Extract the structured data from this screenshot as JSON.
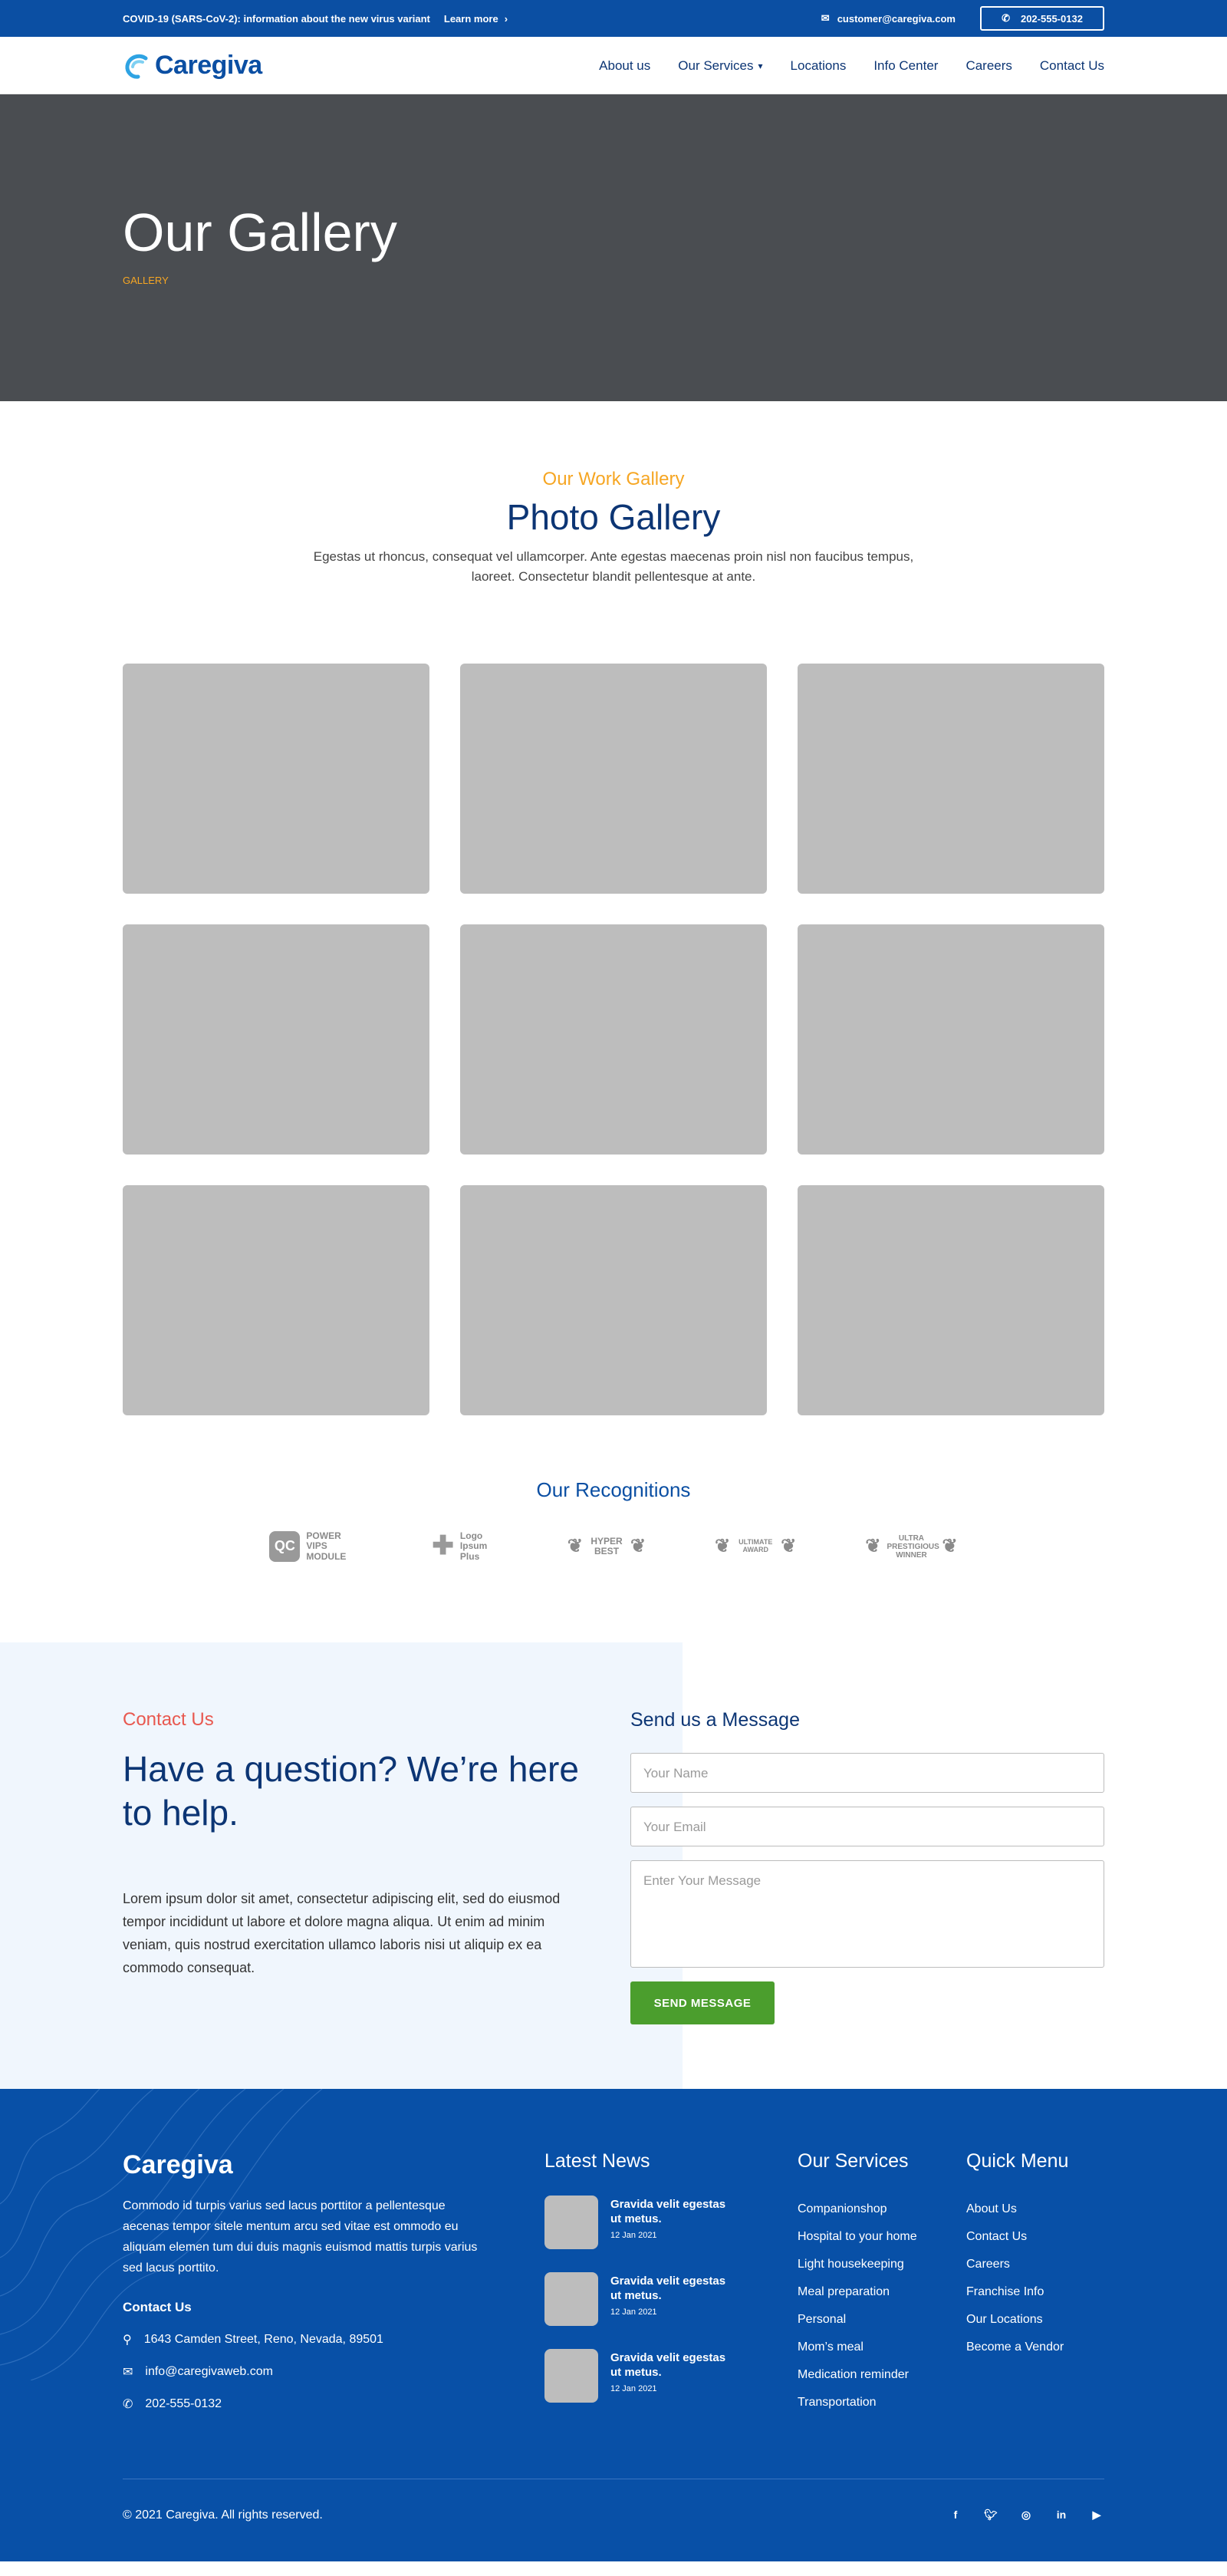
{
  "topbar": {
    "notice": "COVID-19 (SARS-CoV-2): information about the new virus variant",
    "learn_more": "Learn more",
    "email": "customer@caregiva.com",
    "phone": "202-555-0132"
  },
  "nav": {
    "logo": "Caregiva",
    "items": [
      "About us",
      "Our Services",
      "Locations",
      "Info Center",
      "Careers",
      "Contact Us"
    ]
  },
  "hero": {
    "title": "Our Gallery",
    "breadcrumb": "GALLERY"
  },
  "gallery": {
    "kicker": "Our Work Gallery",
    "title": "Photo Gallery",
    "description": "Egestas ut rhoncus, consequat vel ullamcorper. Ante egestas maecenas proin nisl non faucibus tempus, laoreet. Consectetur blandit pellentesque at ante."
  },
  "recognitions": {
    "title": "Our Recognitions",
    "badges": [
      "POWER VIPS MODULE",
      "Logo Ipsum Plus",
      "HYPER BEST",
      "ULTIMATE AWARD",
      "ULTRA PRESTIGIOUS WINNER"
    ]
  },
  "contact": {
    "kicker": "Contact Us",
    "title": "Have a question? We’re here to help.",
    "body": "Lorem ipsum dolor sit amet, consectetur adipiscing elit, sed do eiusmod tempor incididunt ut labore et dolore magna aliqua. Ut enim ad minim veniam, quis nostrud exercitation ullamco laboris nisi ut aliquip ex ea commodo consequat.",
    "form_title": "Send us a Message",
    "name_placeholder": "Your Name",
    "email_placeholder": "Your Email",
    "message_placeholder": "Enter Your Message",
    "send_label": "SEND MESSAGE"
  },
  "footer": {
    "logo": "Caregiva",
    "about": "Commodo id turpis varius sed lacus porttitor a pellentesque aecenas tempor sitele mentum arcu sed vitae est ommodo eu aliquam elemen tum dui duis magnis euismod mattis turpis varius sed lacus porttito.",
    "contact_title": "Contact Us",
    "address": "1643  Camden Street, Reno, Nevada, 89501",
    "email": "info@caregivaweb.com",
    "phone": "202-555-0132",
    "news_title": "Latest News",
    "news": [
      {
        "title": "Gravida velit egestas ut metus.",
        "date": "12 Jan 2021"
      },
      {
        "title": "Gravida velit egestas ut metus.",
        "date": "12 Jan 2021"
      },
      {
        "title": "Gravida velit egestas ut metus.",
        "date": "12 Jan 2021"
      }
    ],
    "services_title": "Our Services",
    "services": [
      "Companionshop",
      "Hospital to your home",
      "Light housekeeping",
      "Meal preparation",
      "Personal",
      "Mom’s meal",
      "Medication reminder",
      "Transportation"
    ],
    "quick_title": "Quick Menu",
    "quick": [
      "About Us",
      "Contact Us",
      "Careers",
      "Franchise Info",
      "Our Locations",
      "Become a Vendor"
    ],
    "copyright": "© 2021 Caregiva. All rights reserved."
  },
  "colors": {
    "brand": "#0b4fa3",
    "accent": "#f6a623",
    "send": "#4b9e2d"
  }
}
